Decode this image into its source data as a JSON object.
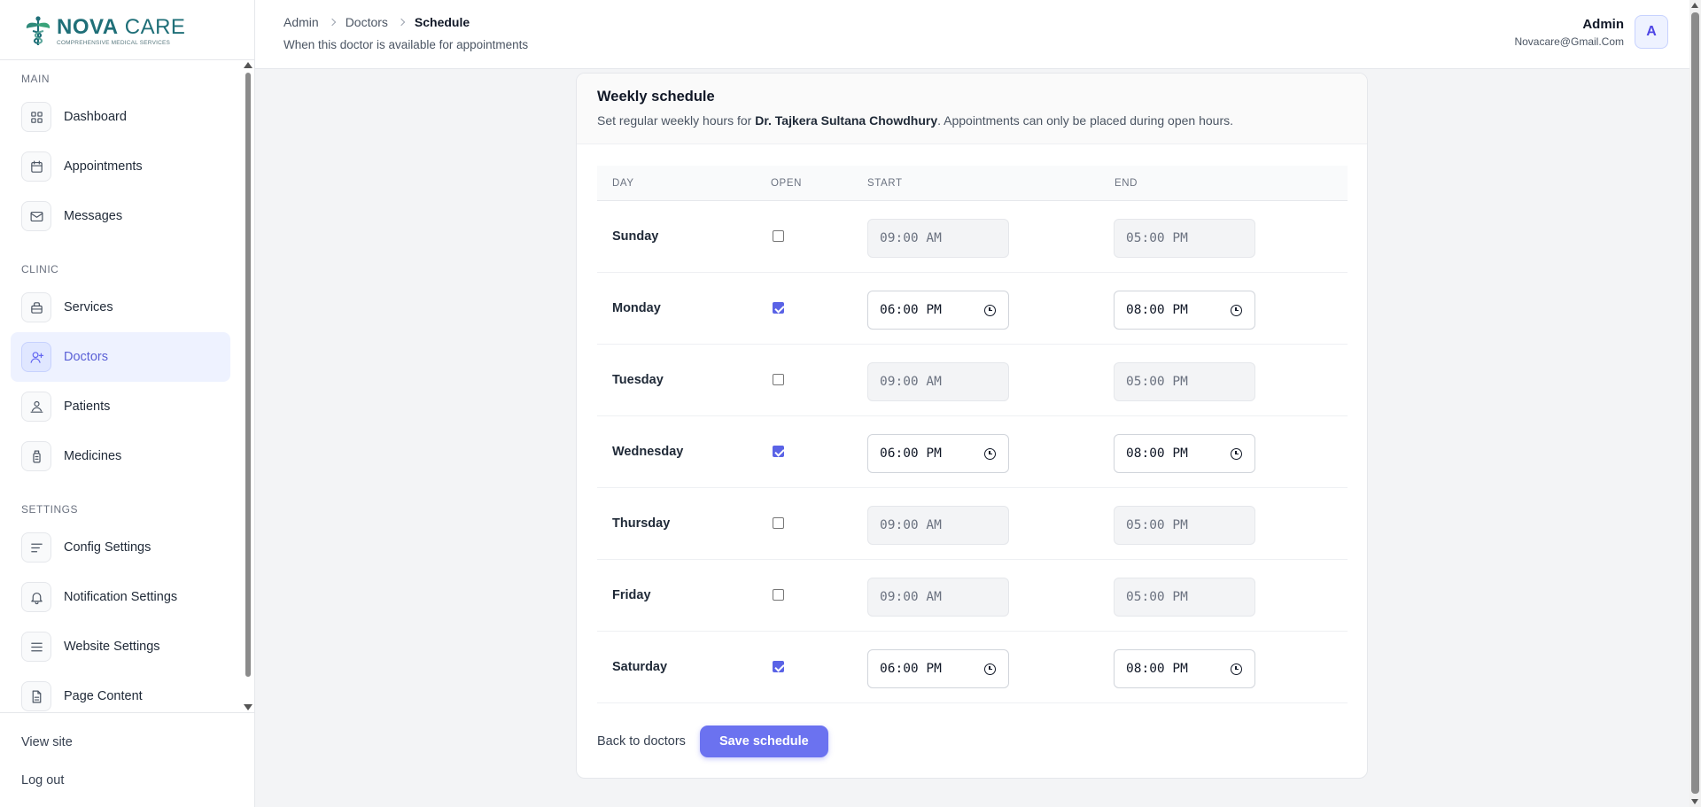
{
  "brand": {
    "name_bold": "NOVA",
    "name_rest": " CARE",
    "tagline": "COMPREHENSIVE MEDICAL SERVICES"
  },
  "sidebar": {
    "sections": [
      {
        "title": "MAIN",
        "items": [
          {
            "label": "Dashboard",
            "icon": "grid-icon"
          },
          {
            "label": "Appointments",
            "icon": "calendar-icon"
          },
          {
            "label": "Messages",
            "icon": "mail-icon"
          }
        ]
      },
      {
        "title": "CLINIC",
        "items": [
          {
            "label": "Services",
            "icon": "briefcase-icon"
          },
          {
            "label": "Doctors",
            "icon": "user-plus-icon",
            "active": true
          },
          {
            "label": "Patients",
            "icon": "patients-icon"
          },
          {
            "label": "Medicines",
            "icon": "medicine-bottle-icon"
          }
        ]
      },
      {
        "title": "SETTINGS",
        "items": [
          {
            "label": "Config Settings",
            "icon": "lines-icon"
          },
          {
            "label": "Notification Settings",
            "icon": "bell-icon"
          },
          {
            "label": "Website Settings",
            "icon": "menu-icon"
          },
          {
            "label": "Page Content",
            "icon": "document-icon"
          }
        ]
      }
    ],
    "bottom": {
      "view_site": "View site",
      "logout": "Log out"
    }
  },
  "header": {
    "breadcrumb": [
      "Admin",
      "Doctors",
      "Schedule"
    ],
    "subtitle": "When this doctor is available for appointments",
    "user": {
      "name": "Admin",
      "email": "Novacare@Gmail.Com",
      "avatar_letter": "A"
    }
  },
  "schedule": {
    "title": "Weekly schedule",
    "desc_prefix": "Set regular weekly hours for ",
    "doctor": "Dr. Tajkera Sultana Chowdhury",
    "desc_suffix": ". Appointments can only be placed during open hours.",
    "columns": {
      "day": "DAY",
      "open": "OPEN",
      "start": "START",
      "end": "END"
    },
    "days": [
      {
        "day": "Sunday",
        "open": false,
        "start": "09:00 AM",
        "end": "05:00 PM"
      },
      {
        "day": "Monday",
        "open": true,
        "start": "06:00 PM",
        "end": "08:00 PM"
      },
      {
        "day": "Tuesday",
        "open": false,
        "start": "09:00 AM",
        "end": "05:00 PM"
      },
      {
        "day": "Wednesday",
        "open": true,
        "start": "06:00 PM",
        "end": "08:00 PM"
      },
      {
        "day": "Thursday",
        "open": false,
        "start": "09:00 AM",
        "end": "05:00 PM"
      },
      {
        "day": "Friday",
        "open": false,
        "start": "09:00 AM",
        "end": "05:00 PM"
      },
      {
        "day": "Saturday",
        "open": true,
        "start": "06:00 PM",
        "end": "08:00 PM"
      }
    ],
    "back_label": "Back to doctors",
    "save_label": "Save schedule"
  },
  "colors": {
    "accent": "#6b72f0",
    "brand": "#1f6f78",
    "active_bg": "#eef2ff"
  }
}
